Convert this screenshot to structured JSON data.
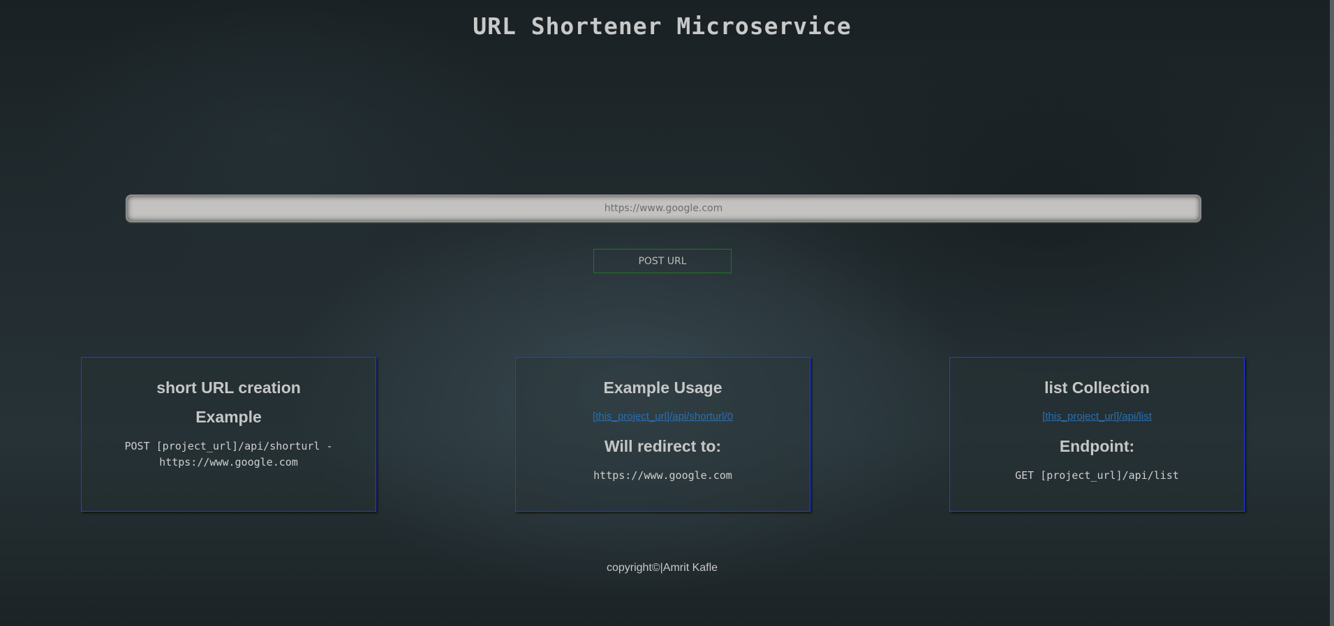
{
  "page": {
    "title": "URL Shortener Microservice"
  },
  "form": {
    "url_placeholder": "https://www.google.com",
    "submit_label": "POST URL"
  },
  "cards": [
    {
      "heading": "short URL creation",
      "subheading": "Example",
      "code_line_1": "POST [project_url]/api/shorturl -",
      "code_line_2": "https://www.google.com"
    },
    {
      "heading": "Example Usage",
      "link": "[this_project_url]/api/shorturl/0",
      "subheading": "Will redirect to:",
      "code": "https://www.google.com"
    },
    {
      "heading": "list Collection",
      "link": "[this_project_url]/api/list",
      "subheading": "Endpoint:",
      "code": "GET [project_url]/api/list"
    }
  ],
  "footer": {
    "text": "copyright©|Amrit Kafle"
  },
  "colors": {
    "card_border": "#1e3cff",
    "button_border": "#1b7c1b",
    "link": "#2a6fb0"
  }
}
